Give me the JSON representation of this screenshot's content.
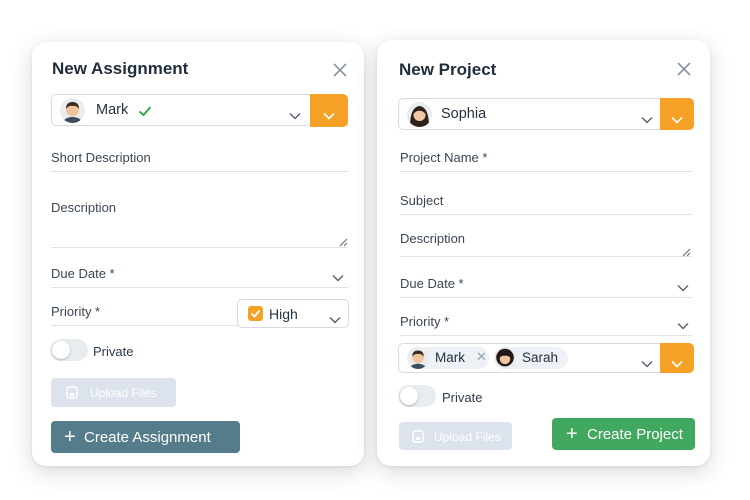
{
  "assignment": {
    "title": "New Assignment",
    "assignee": "Mark",
    "short_description_label": "Short Description",
    "description_label": "Description",
    "due_date_label": "Due Date *",
    "priority_label": "Priority *",
    "priority_value": "High",
    "private_label": "Private",
    "upload_label": "Upload Files",
    "create_label": "Create Assignment"
  },
  "project": {
    "title": "New Project",
    "owner": "Sophia",
    "project_name_label": "Project Name *",
    "subject_label": "Subject",
    "description_label": "Description",
    "due_date_label": "Due Date *",
    "priority_label": "Priority *",
    "members": [
      {
        "name": "Mark"
      },
      {
        "name": "Sarah"
      }
    ],
    "private_label": "Private",
    "upload_label": "Upload Files",
    "create_label": "Create Project"
  },
  "colors": {
    "accent_orange": "#f5a127",
    "create_assignment_bg": "#547c8a",
    "create_project_bg": "#41a85f",
    "check_green": "#2fa84f"
  }
}
